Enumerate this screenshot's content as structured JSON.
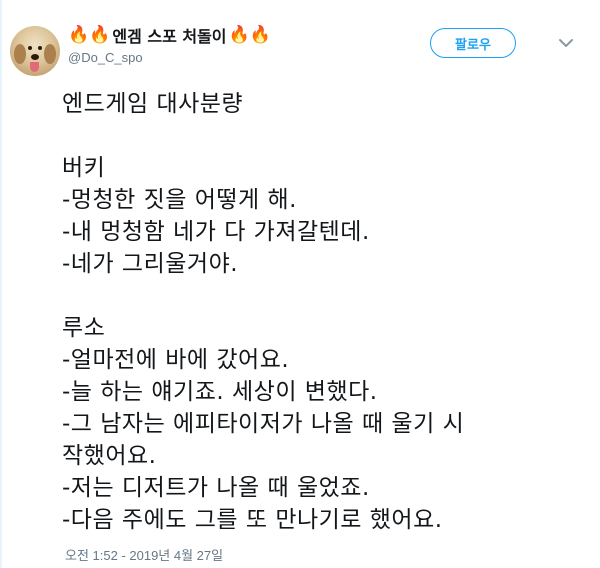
{
  "colors": {
    "accent": "#1da1f2",
    "text": "#14171a",
    "muted": "#657786",
    "fire": "#f4900c"
  },
  "user": {
    "fire_emoji": "🔥",
    "display_name": "엔겜 스포 처돌이",
    "handle": "@Do_C_spo",
    "avatar_icon": "dog-avatar"
  },
  "actions": {
    "follow_label": "팔로우",
    "more_icon": "chevron-down-icon"
  },
  "tweet": {
    "title": "엔드게임 대사분량",
    "sections": [
      {
        "speaker": "버키",
        "lines": [
          "-멍청한 짓을 어떻게 해.",
          "-내 멍청함 네가 다 가져갈텐데.",
          "-네가 그리울거야."
        ]
      },
      {
        "speaker": "루소",
        "lines": [
          "-얼마전에 바에 갔어요.",
          "-늘 하는 얘기죠. 세상이 변했다.",
          "-그 남자는 에피타이저가 나올 때 울기 시",
          "작했어요.",
          "-저는 디저트가 나올 때 울었죠.",
          "-다음 주에도 그를 또 만나기로 했어요."
        ]
      }
    ],
    "timestamp": "오전 1:52 - 2019년 4월 27일"
  }
}
